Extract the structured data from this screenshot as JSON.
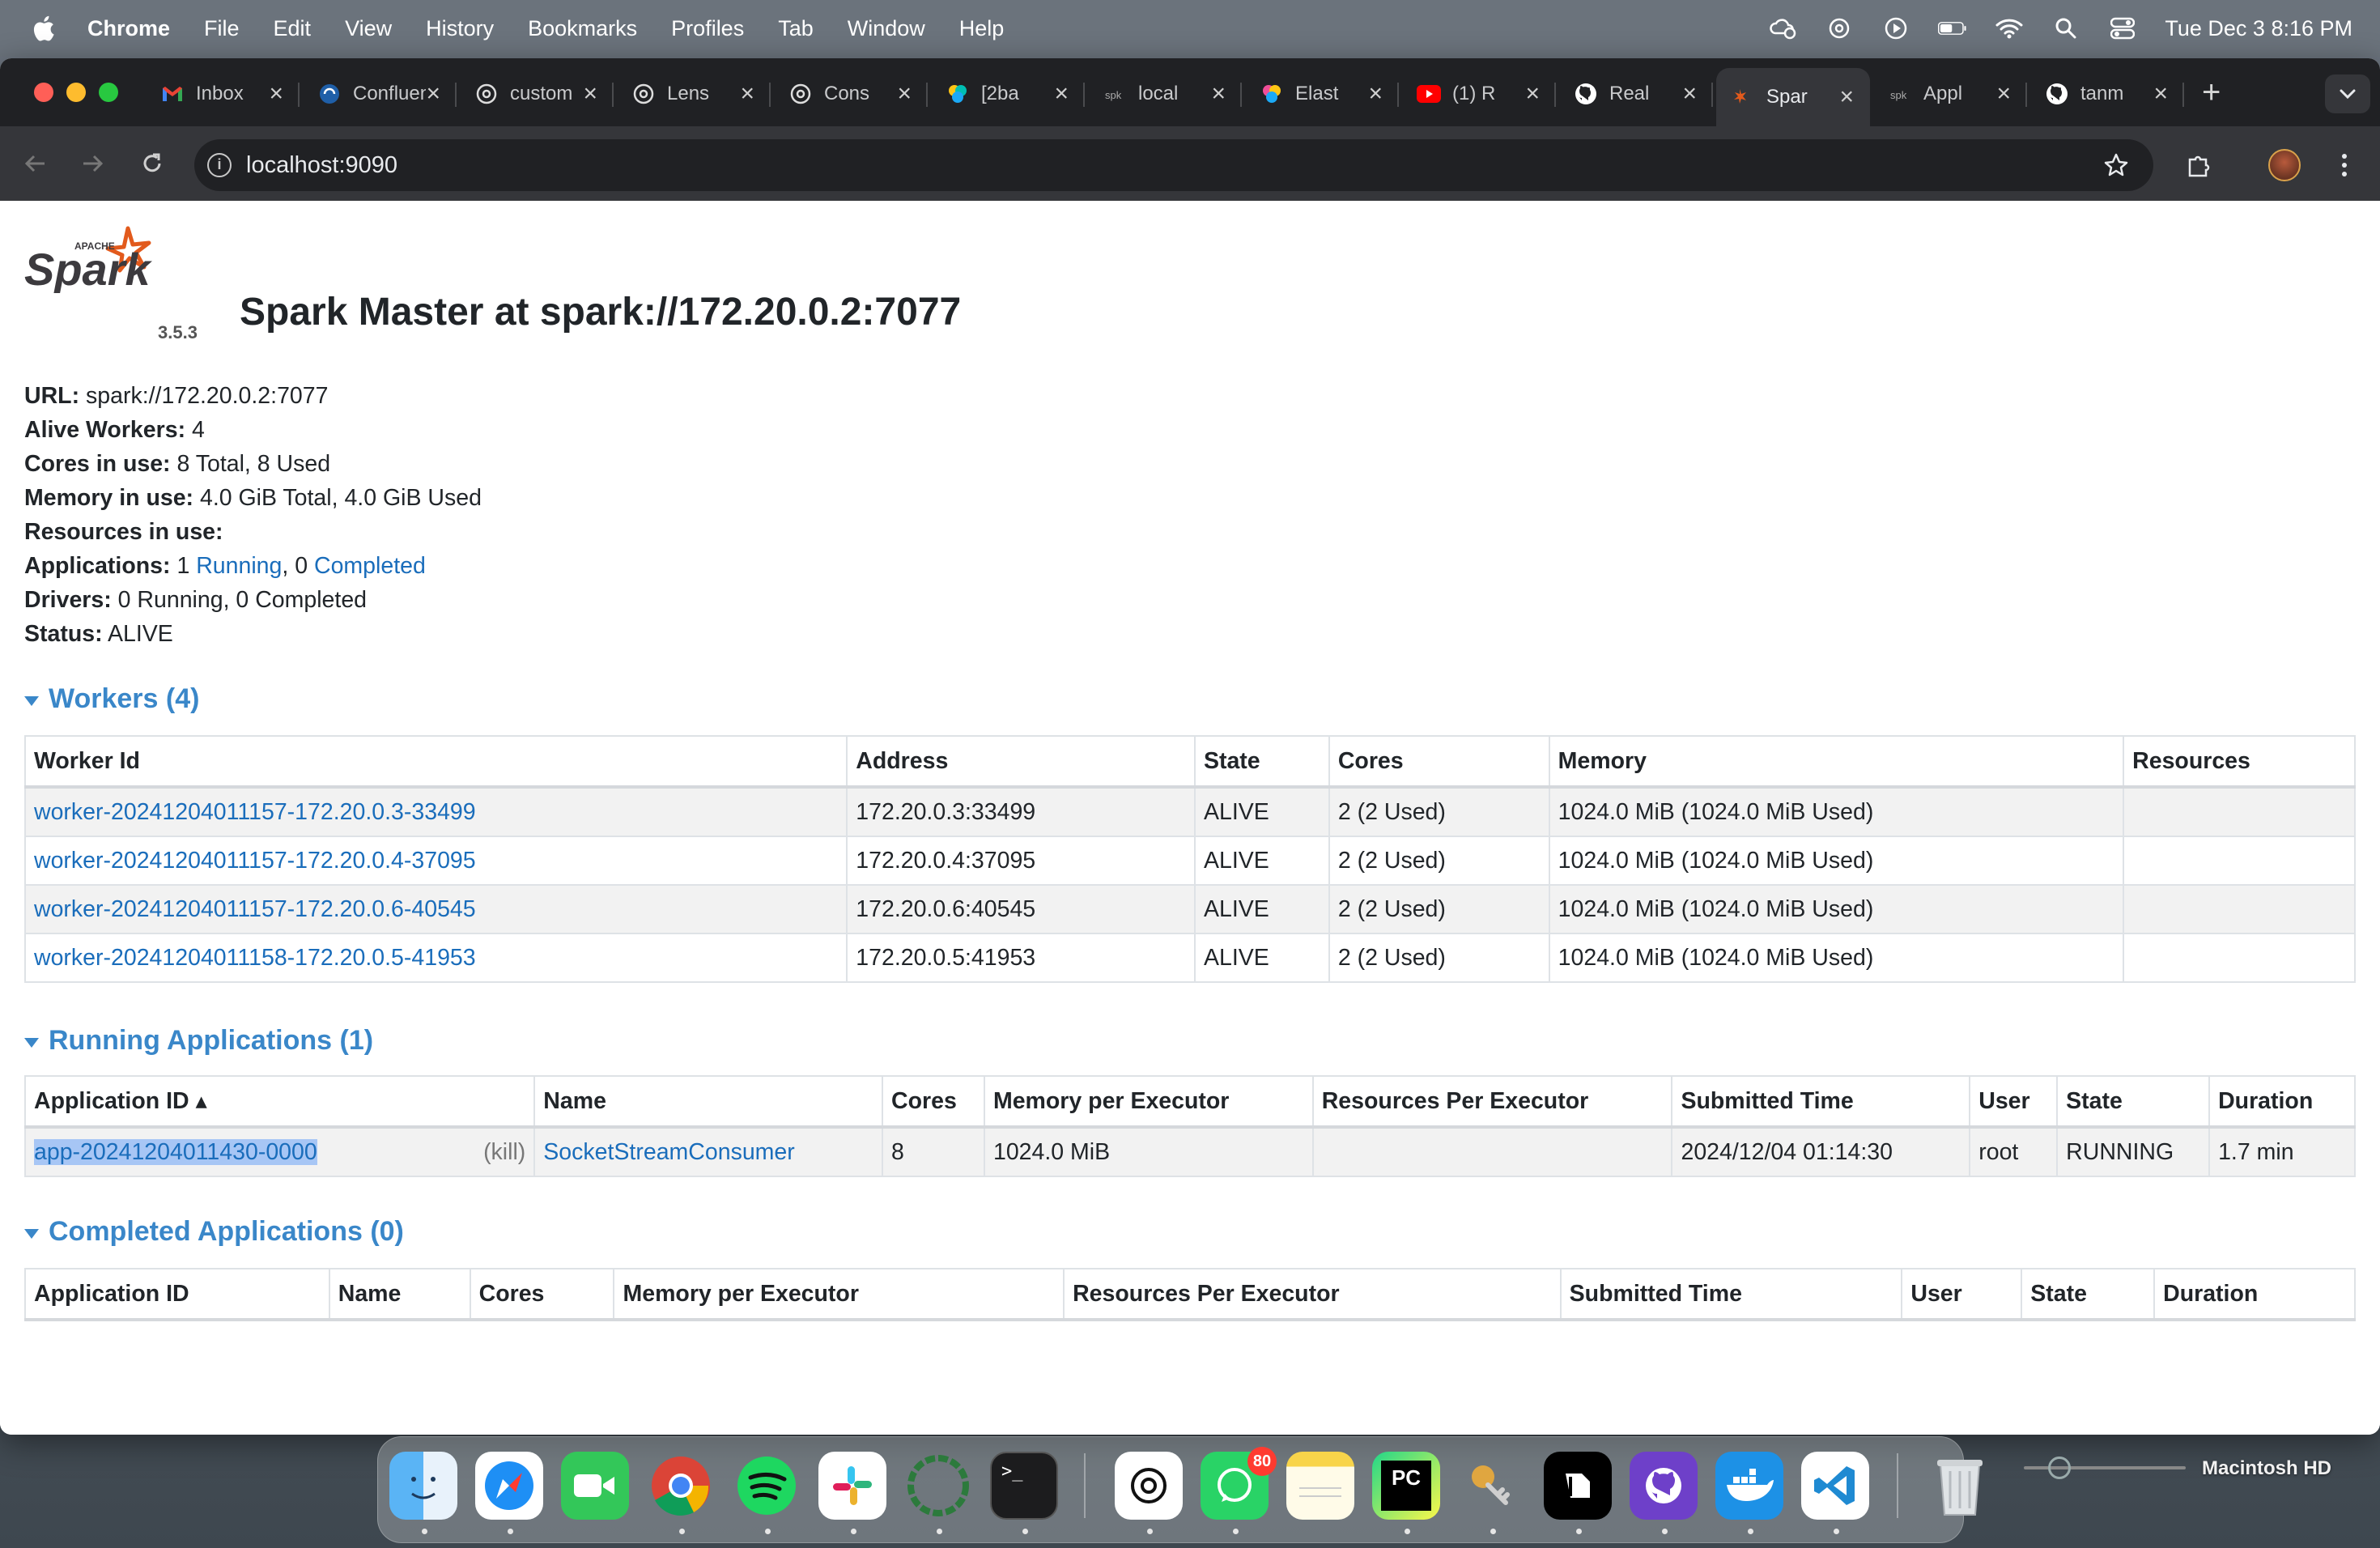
{
  "menubar": {
    "app_name": "Chrome",
    "menus": [
      "File",
      "Edit",
      "View",
      "History",
      "Bookmarks",
      "Profiles",
      "Tab",
      "Window",
      "Help"
    ],
    "datetime": "Tue Dec 3  8:16 PM"
  },
  "browser": {
    "tabs": [
      {
        "title": "Inbox",
        "icon": "gmail-icon",
        "active": false
      },
      {
        "title": "Confluent",
        "icon": "confluent-icon",
        "active": false
      },
      {
        "title": "custom",
        "icon": "openai-icon",
        "active": false
      },
      {
        "title": "Lens",
        "icon": "openai-icon",
        "active": false
      },
      {
        "title": "Cons",
        "icon": "openai-icon",
        "active": false
      },
      {
        "title": "[2ba",
        "icon": "elastic-icon",
        "active": false
      },
      {
        "title": "local",
        "icon": "spark-icon",
        "active": false
      },
      {
        "title": "Elast",
        "icon": "elastic-icon",
        "active": false
      },
      {
        "title": "(1) R",
        "icon": "youtube-icon",
        "active": false
      },
      {
        "title": "Real",
        "icon": "github-icon",
        "active": false
      },
      {
        "title": "Spar",
        "icon": "spark-icon",
        "active": true
      },
      {
        "title": "Appl",
        "icon": "spark-icon",
        "active": false
      },
      {
        "title": "tanm",
        "icon": "github-icon",
        "active": false
      }
    ],
    "address": "localhost:9090"
  },
  "spark": {
    "version": "3.5.3",
    "title": "Spark Master at spark://172.20.0.2:7077",
    "summary": {
      "url_label": "URL:",
      "url_value": "spark://172.20.0.2:7077",
      "alive_workers_label": "Alive Workers:",
      "alive_workers_value": "4",
      "cores_label": "Cores in use:",
      "cores_value": "8 Total, 8 Used",
      "memory_label": "Memory in use:",
      "memory_value": "4.0 GiB Total, 4.0 GiB Used",
      "resources_label": "Resources in use:",
      "applications_label": "Applications:",
      "apps_running_count": "1",
      "apps_running_link": "Running",
      "apps_sep": ", 0",
      "apps_completed_link": "Completed",
      "drivers_label": "Drivers:",
      "drivers_value": "0 Running, 0 Completed",
      "status_label": "Status:",
      "status_value": "ALIVE"
    },
    "workers": {
      "heading": "Workers (4)",
      "columns": [
        "Worker Id",
        "Address",
        "State",
        "Cores",
        "Memory",
        "Resources"
      ],
      "rows": [
        {
          "id": "worker-20241204011157-172.20.0.3-33499",
          "address": "172.20.0.3:33499",
          "state": "ALIVE",
          "cores": "2 (2 Used)",
          "memory": "1024.0 MiB (1024.0 MiB Used)",
          "resources": ""
        },
        {
          "id": "worker-20241204011157-172.20.0.4-37095",
          "address": "172.20.0.4:37095",
          "state": "ALIVE",
          "cores": "2 (2 Used)",
          "memory": "1024.0 MiB (1024.0 MiB Used)",
          "resources": ""
        },
        {
          "id": "worker-20241204011157-172.20.0.6-40545",
          "address": "172.20.0.6:40545",
          "state": "ALIVE",
          "cores": "2 (2 Used)",
          "memory": "1024.0 MiB (1024.0 MiB Used)",
          "resources": ""
        },
        {
          "id": "worker-20241204011158-172.20.0.5-41953",
          "address": "172.20.0.5:41953",
          "state": "ALIVE",
          "cores": "2 (2 Used)",
          "memory": "1024.0 MiB (1024.0 MiB Used)",
          "resources": ""
        }
      ]
    },
    "running_apps": {
      "heading": "Running Applications (1)",
      "columns": [
        "Application ID ▴",
        "Name",
        "Cores",
        "Memory per Executor",
        "Resources Per Executor",
        "Submitted Time",
        "User",
        "State",
        "Duration"
      ],
      "rows": [
        {
          "id": "app-20241204011430-0000",
          "kill": "(kill)",
          "name": "SocketStreamConsumer",
          "cores": "8",
          "memory": "1024.0 MiB",
          "resources": "",
          "submitted": "2024/12/04 01:14:30",
          "user": "root",
          "state": "RUNNING",
          "duration": "1.7 min"
        }
      ]
    },
    "completed_apps": {
      "heading": "Completed Applications (0)",
      "columns": [
        "Application ID",
        "Name",
        "Cores",
        "Memory per Executor",
        "Resources Per Executor",
        "Submitted Time",
        "User",
        "State",
        "Duration"
      ]
    }
  },
  "desktop": {
    "disk_label": "Macintosh HD",
    "dock_apps": [
      "finder",
      "safari",
      "facetime",
      "chrome",
      "spotify",
      "slack",
      "activity",
      "terminal",
      "chatgpt",
      "whatsapp",
      "notes",
      "pycharm",
      "keychain",
      "notion",
      "github-desktop",
      "docker",
      "vscode",
      "trash"
    ],
    "whatsapp_badge": "80"
  }
}
